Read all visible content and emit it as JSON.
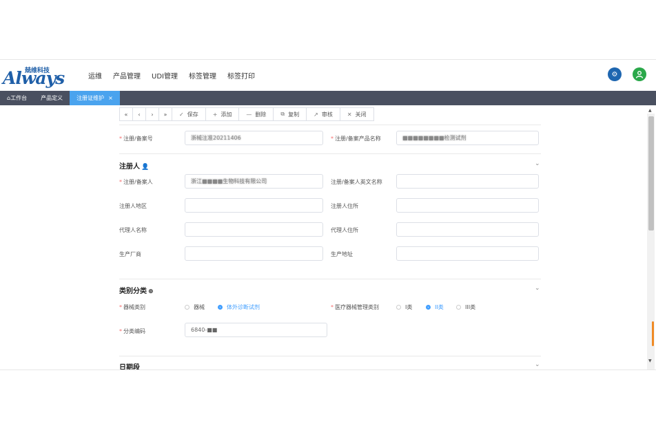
{
  "header": {
    "logo_text": "Always",
    "logo_cn": "兢维科技",
    "nav": [
      "运维",
      "产品管理",
      "UDI管理",
      "标签管理",
      "标签打印"
    ],
    "icons": [
      "settings-icon",
      "user-icon"
    ],
    "icon_colors": [
      "#1e66b0",
      "#2aa84a"
    ]
  },
  "tabs": [
    {
      "label": "工作台",
      "icon": "home-icon"
    },
    {
      "label": "产品定义"
    },
    {
      "label": "注册证维护",
      "active": true,
      "close": "×"
    }
  ],
  "toolbar": {
    "nav_buttons": [
      "«",
      "‹",
      "›",
      "»"
    ],
    "actions": [
      {
        "label": "保存",
        "icon": "✓"
      },
      {
        "label": "添加",
        "icon": "+"
      },
      {
        "label": "删除",
        "icon": "—"
      },
      {
        "label": "复制",
        "icon": "⧉"
      },
      {
        "label": "审核",
        "icon": "↗"
      },
      {
        "label": "关闭",
        "icon": "✕"
      }
    ]
  },
  "form": {
    "reg_no_label": "注册/备案号",
    "reg_no_value": "浙械注准20211406",
    "product_name_label": "注册/备案产品名称",
    "product_name_value": "■■■■■■■■检测试剂",
    "registrant": {
      "title": "注册人",
      "name_label": "注册/备案人",
      "name_value": "浙江■■■■生物科技有限公司",
      "en_name_label": "注册/备案人英文名称",
      "region_label": "注册人地区",
      "address_label": "注册人住所",
      "agent_name_label": "代理人名称",
      "agent_address_label": "代理人住所",
      "manufacturer_label": "生产厂商",
      "production_address_label": "生产地址"
    },
    "category": {
      "title": "类别分类",
      "device_type_label": "器械类别",
      "device_type_options": [
        "器械",
        "体外诊断试剂"
      ],
      "device_type_selected": "体外诊断试剂",
      "mgmt_class_label": "医疗器械管理类别",
      "mgmt_class_options": [
        "I类",
        "II类",
        "III类"
      ],
      "mgmt_class_selected": "II类",
      "code_label": "分类编码",
      "code_value": "6840-■■"
    },
    "date_section_title": "日期段"
  }
}
